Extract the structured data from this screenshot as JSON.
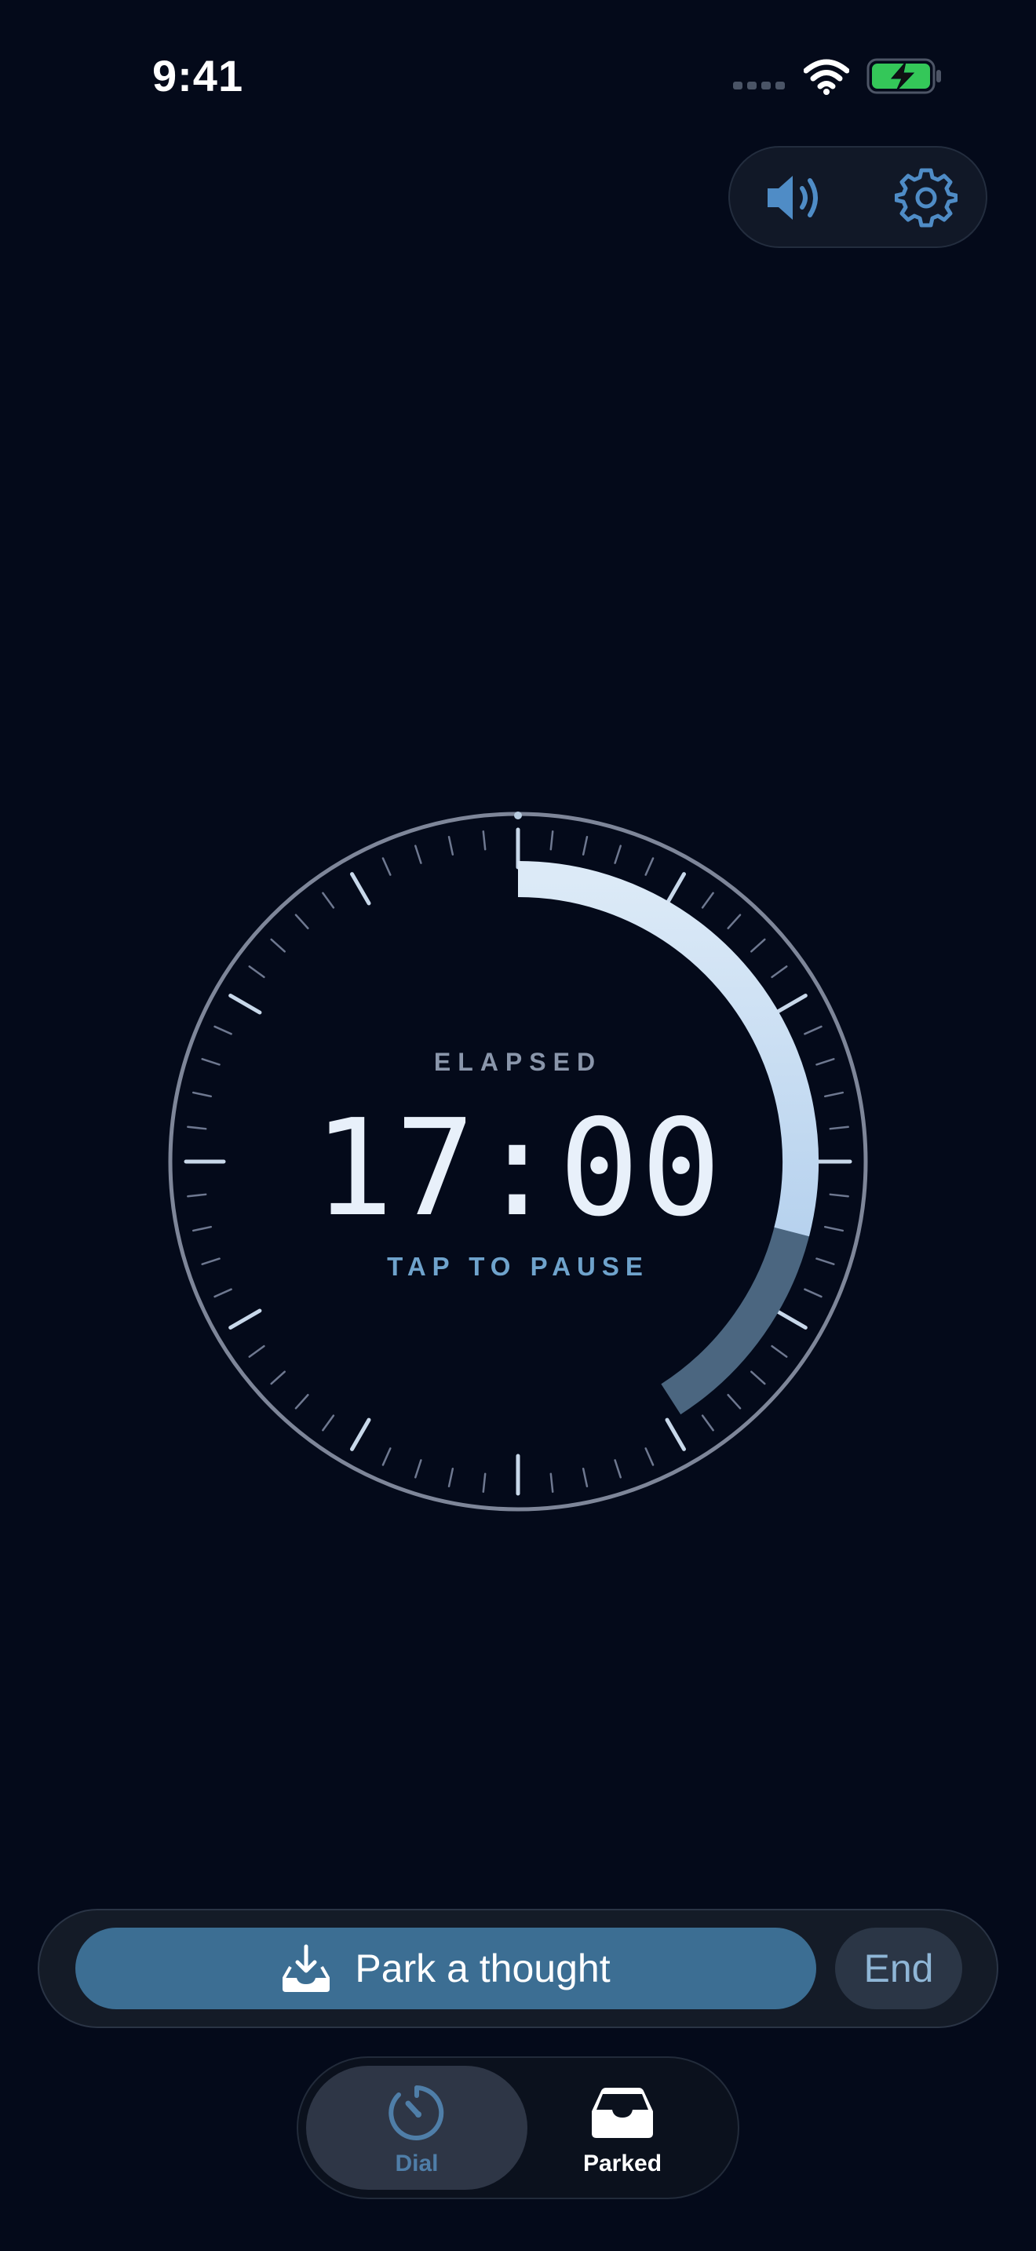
{
  "status_bar": {
    "time": "9:41"
  },
  "icons": {
    "sound": "speaker-icon",
    "settings": "gear-icon",
    "park": "tray-download-icon",
    "dial_tab": "timer-icon",
    "parked_tab": "inbox-icon"
  },
  "timer": {
    "elapsed_label": "ELAPSED",
    "value": "17:00",
    "hint": "TAP TO PAUSE",
    "progress_fraction": 0.42,
    "secondary_fraction": 0.17
  },
  "actions": {
    "park_label": "Park a thought",
    "end_label": "End"
  },
  "tabs": [
    {
      "label": "Dial",
      "active": true
    },
    {
      "label": "Parked",
      "active": false
    }
  ],
  "colors": {
    "background": "#040A1A",
    "accent": "#3C6E93",
    "progress": "#C8DDF2",
    "progress_secondary": "#4B6680",
    "tab_active": "#4F7EA8"
  }
}
